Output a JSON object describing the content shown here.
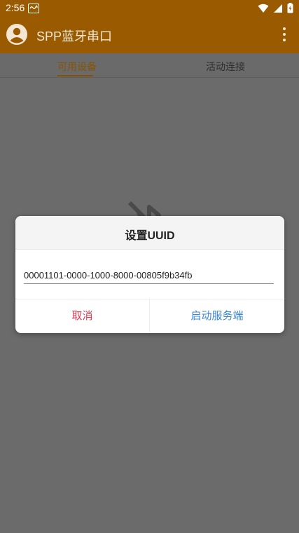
{
  "status_bar": {
    "time": "2:56",
    "notification_icon": "sms-icon",
    "icons": [
      "wifi-icon",
      "signal-icon",
      "battery-icon"
    ]
  },
  "app_bar": {
    "title": "SPP蓝牙串口",
    "avatar_icon": "account-icon",
    "menu_icon": "overflow-menu-icon",
    "color": "#9a5a00"
  },
  "tabs": [
    {
      "label": "可用设备",
      "selected": true
    },
    {
      "label": "活动连接",
      "selected": false
    }
  ],
  "content": {
    "background_icon": "bluetooth-disabled-icon"
  },
  "dialog": {
    "title": "设置UUID",
    "uuid_value": "00001101-0000-1000-8000-00805f9b34fb",
    "cancel_label": "取消",
    "start_label": "启动服务端",
    "cancel_color": "#e0354d",
    "start_color": "#3a86d6"
  }
}
